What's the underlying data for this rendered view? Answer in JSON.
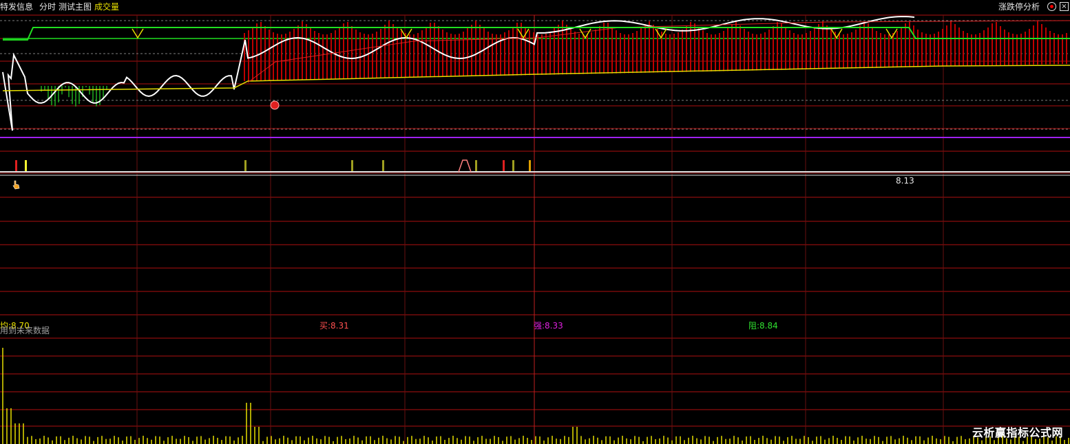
{
  "topbar": {
    "title": "特发信息",
    "mode": "分时",
    "indicator": "测试主图",
    "volume": "成交量",
    "right_title": "涨跌停分析",
    "close_glyph": "×"
  },
  "labels": {
    "price_tag": "8.13",
    "avg": "均:8.70",
    "buy": "买:8.31",
    "strong": "强:8.33",
    "resist": "阻:8.84",
    "future_note": "用到未来数据"
  },
  "watermark": "云析赢指标公式网",
  "icons": {
    "gear": "gear-icon",
    "close": "close-icon",
    "cursor": "hand-cursor-icon",
    "marker": "red-ball-icon"
  },
  "colors": {
    "background": "#000000",
    "grid": "#b01010",
    "price_line": "#ffffff",
    "avg_line": "#e8e000",
    "green_band": "#20e020",
    "red_bars": "#c00000",
    "volume": "#e8e000",
    "purple_line": "#a020f0"
  }
}
